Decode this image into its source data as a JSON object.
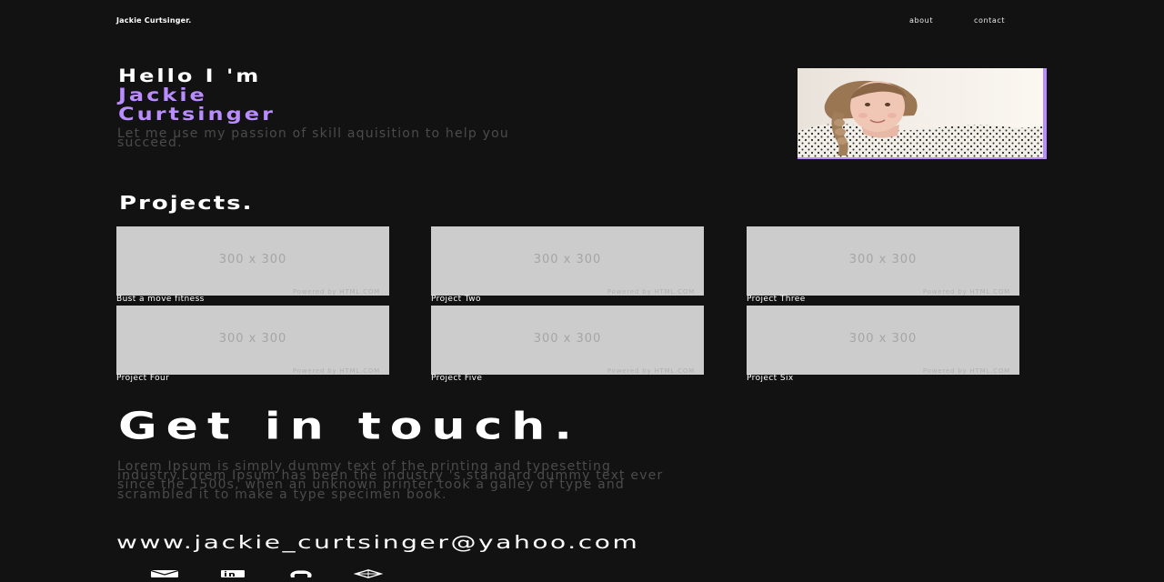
{
  "header": {
    "brand": "Jackie Curtsinger.",
    "nav": [
      {
        "label": "about"
      },
      {
        "label": "contact"
      }
    ]
  },
  "hero": {
    "greeting": "Hello I 'm",
    "name_line1": "Jackie",
    "name_line2": "Curtsinger",
    "tagline": "Let me use my passion of skill aquisition to help you succeed.",
    "accent_color": "#b98cff"
  },
  "projects": {
    "title": "Projects.",
    "placeholder_text": "300 x 300",
    "powered_text": "Powered by HTML.COM",
    "items": [
      {
        "label": "Bust a move fitness"
      },
      {
        "label": "Project Two"
      },
      {
        "label": "Project Three"
      },
      {
        "label": "Project Four"
      },
      {
        "label": "Project Five"
      },
      {
        "label": "Project Six"
      }
    ]
  },
  "contact": {
    "title": "Get in touch.",
    "body": "Lorem Ipsum is simply dummy text of the printing and typesetting industry.Lorem Ipsum has been the industry 's standard dummy text ever since the 1500s, when an unknown printer took a galley of type and scrambled it to make a type specimen book.",
    "email": "www.jackie_curtsinger@yahoo.com",
    "social_icons": [
      "mail-icon",
      "linkedin-icon",
      "github-icon",
      "codepen-icon"
    ]
  }
}
